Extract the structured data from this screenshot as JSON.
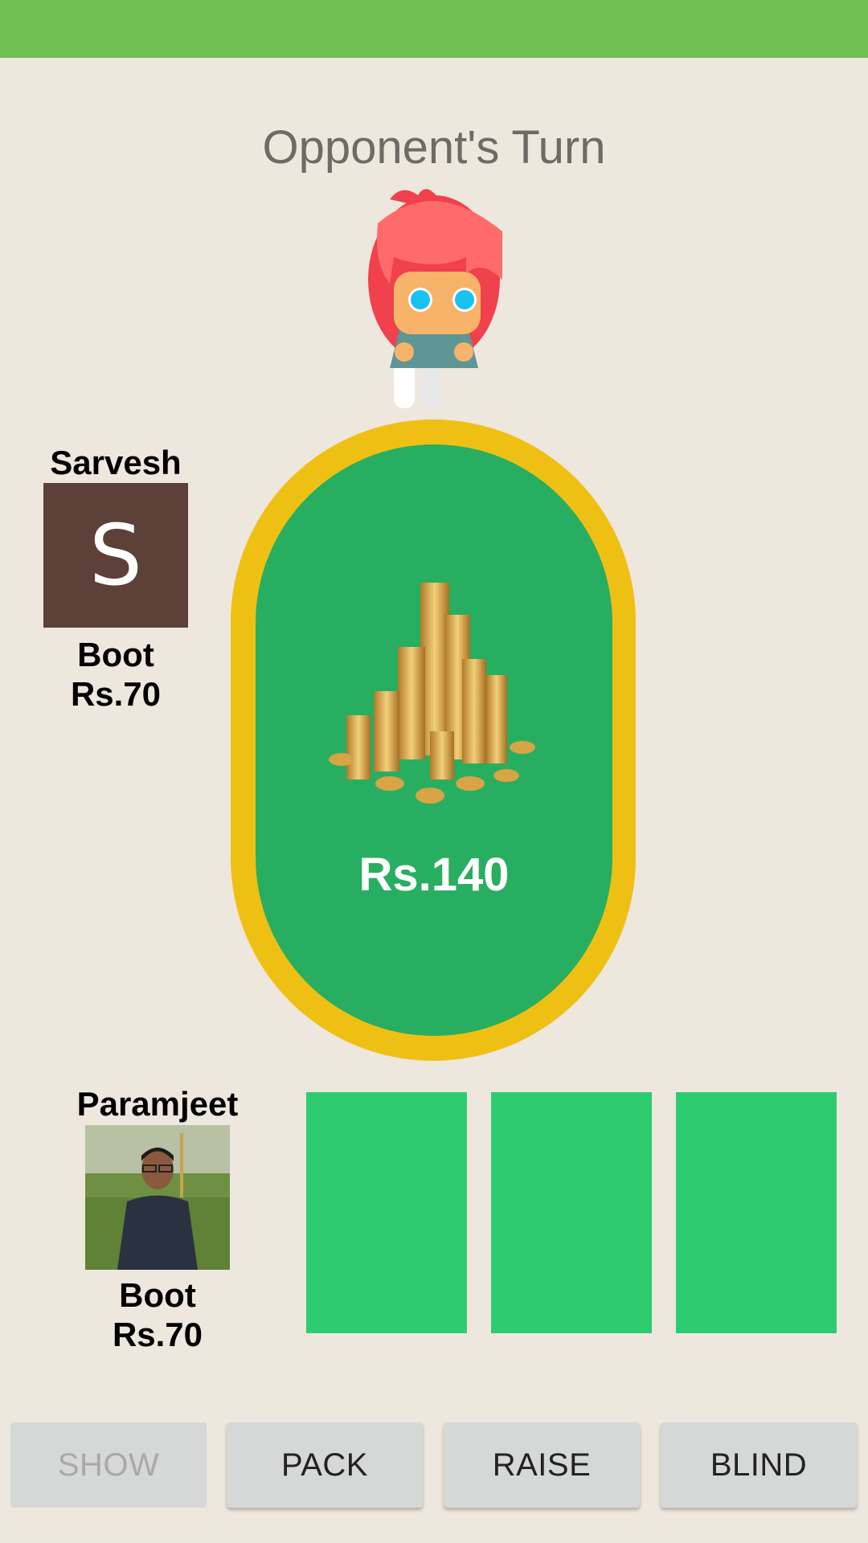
{
  "turn_text": "Opponent's Turn",
  "opponent": {
    "name": "Sarvesh",
    "initial": "S",
    "avatar_color": "#5D4037",
    "bet_label": "Boot",
    "bet_amount": "Rs.70"
  },
  "pot": {
    "amount": "Rs.140",
    "image": "coin-stack"
  },
  "player": {
    "name": "Paramjeet",
    "bet_label": "Boot",
    "bet_amount": "Rs.70"
  },
  "cards": [
    {
      "face": "hidden",
      "color": "#2ECC71"
    },
    {
      "face": "hidden",
      "color": "#2ECC71"
    },
    {
      "face": "hidden",
      "color": "#2ECC71"
    }
  ],
  "actions": {
    "show": "SHOW",
    "pack": "PACK",
    "raise": "RAISE",
    "blind": "BLIND"
  },
  "colors": {
    "status_bar": "#70BF52",
    "table_rim": "#EFC014",
    "table_felt": "#28AE60",
    "background": "#EEE7DE"
  }
}
